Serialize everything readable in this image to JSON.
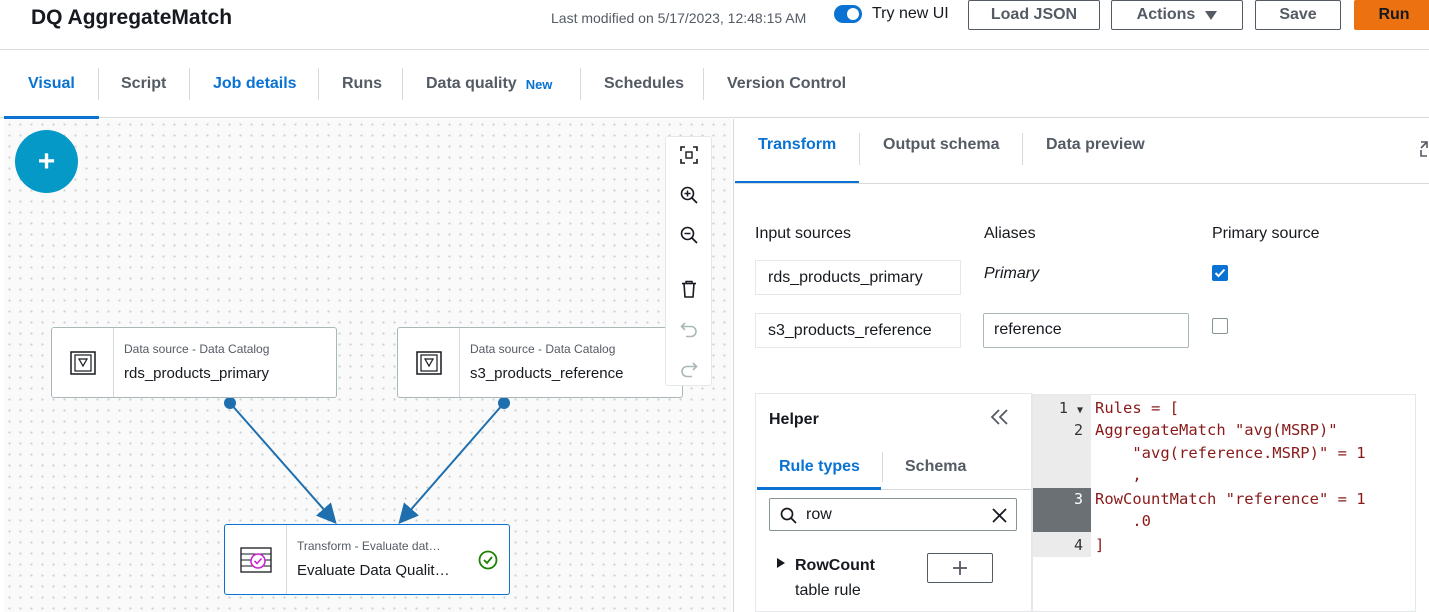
{
  "header": {
    "title": "DQ AggregateMatch",
    "last_modified": "Last modified on 5/17/2023, 12:48:15 AM",
    "toggle_label": "Try new UI",
    "load_json": "Load JSON",
    "actions": "Actions",
    "save": "Save",
    "run": "Run"
  },
  "tabs": [
    {
      "label": "Visual"
    },
    {
      "label": "Script"
    },
    {
      "label": "Job details"
    },
    {
      "label": "Runs"
    },
    {
      "label": "Data quality",
      "badge": "New"
    },
    {
      "label": "Schedules"
    },
    {
      "label": "Version Control"
    }
  ],
  "canvas": {
    "add_label": "+",
    "nodes": [
      {
        "type": "Data source - Data Catalog",
        "name": "rds_products_primary",
        "icon": "catalog-icon"
      },
      {
        "type": "Data source - Data Catalog",
        "name": "s3_products_reference",
        "icon": "catalog-icon"
      },
      {
        "type": "Transform - Evaluate dat…",
        "name": "Evaluate Data Qualit…",
        "icon": "data-quality-icon",
        "status": "success"
      }
    ],
    "toolbar_icons": [
      "fit-screen-icon",
      "zoom-in-icon",
      "zoom-out-icon",
      "delete-icon",
      "undo-icon",
      "redo-icon"
    ]
  },
  "panel": {
    "tabs": [
      {
        "label": "Transform"
      },
      {
        "label": "Output schema"
      },
      {
        "label": "Data preview"
      }
    ],
    "columns": {
      "input_sources": "Input sources",
      "aliases": "Aliases",
      "primary_source": "Primary source"
    },
    "sources": [
      {
        "name": "rds_products_primary",
        "alias": "Primary",
        "primary": true
      },
      {
        "name": "s3_products_reference",
        "alias": "reference",
        "primary": false
      }
    ],
    "helper": {
      "title": "Helper",
      "tabs": [
        {
          "label": "Rule types"
        },
        {
          "label": "Schema"
        }
      ],
      "search_value": "row",
      "rule": {
        "name": "RowCount",
        "sub": "table rule"
      }
    },
    "editor": {
      "lines": [
        {
          "n": "1"
        },
        {
          "n": "2"
        },
        {
          "n": "3"
        },
        {
          "n": "4"
        }
      ],
      "code": {
        "l1": "Rules = [",
        "l2a": "AggregateMatch \"avg(MSRP)\"",
        "l2b": "    \"avg(reference.MSRP)\" = 1",
        "l2c": "    ,",
        "l3a": "RowCountMatch \"reference\" = 1",
        "l3b": "    .0",
        "l4": "]"
      }
    }
  },
  "colors": {
    "accent": "#0972d3",
    "run_button": "#ec7211",
    "add_button": "#0599c7",
    "edge": "#1f6fae",
    "success": "#1d8102"
  }
}
